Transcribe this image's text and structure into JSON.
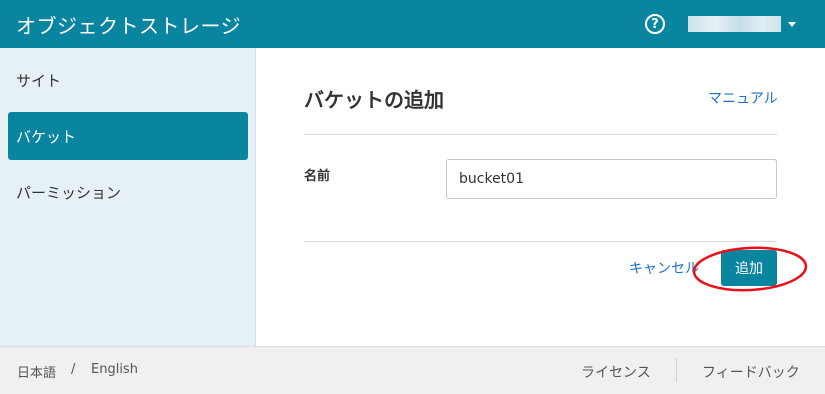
{
  "header": {
    "title": "オブジェクトストレージ",
    "help_icon": "question-circle-icon",
    "user_name": "",
    "caret_icon": "caret-down-icon",
    "background_color": "#0a85a0"
  },
  "sidebar": {
    "items": [
      {
        "label": "サイト",
        "active": false
      },
      {
        "label": "バケット",
        "active": true
      },
      {
        "label": "パーミッション",
        "active": false
      }
    ]
  },
  "main": {
    "title": "バケットの追加",
    "manual_link": "マニュアル",
    "name_label": "名前",
    "name_value": "bucket01",
    "cancel_label": "キャンセル",
    "add_label": "追加",
    "highlight_color": "#e8111b"
  },
  "footer": {
    "lang_ja": "日本語",
    "lang_separator": "/",
    "lang_en": "English",
    "license": "ライセンス",
    "feedback": "フィードバック"
  }
}
